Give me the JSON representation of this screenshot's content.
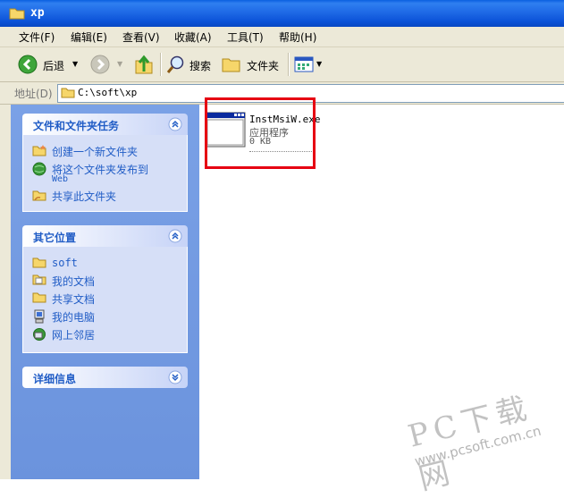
{
  "window": {
    "title": "xp"
  },
  "menu": [
    "文件(F)",
    "编辑(E)",
    "查看(V)",
    "收藏(A)",
    "工具(T)",
    "帮助(H)"
  ],
  "toolbar": {
    "back_label": "后退",
    "search_label": "搜索",
    "folders_label": "文件夹"
  },
  "address": {
    "label": "地址(D)",
    "path": "C:\\soft\\xp"
  },
  "file_tasks": {
    "title": "文件和文件夹任务",
    "items": [
      {
        "label": "创建一个新文件夹",
        "icon": "new-folder-icon"
      },
      {
        "label": "将这个文件夹发布到",
        "label2": "Web",
        "icon": "publish-web-icon"
      },
      {
        "label": "共享此文件夹",
        "icon": "share-folder-icon"
      }
    ]
  },
  "other_places": {
    "title": "其它位置",
    "items": [
      {
        "label": "soft",
        "icon": "folder-icon"
      },
      {
        "label": "我的文档",
        "icon": "my-documents-icon"
      },
      {
        "label": "共享文档",
        "icon": "shared-documents-icon"
      },
      {
        "label": "我的电脑",
        "icon": "my-computer-icon"
      },
      {
        "label": "网上邻居",
        "icon": "network-places-icon"
      }
    ]
  },
  "details": {
    "title": "详细信息"
  },
  "file": {
    "name": "InstMsiW.exe",
    "type": "应用程序",
    "size": "0 KB"
  },
  "watermark": {
    "brand": "PC下载网",
    "url": "www.pcsoft.com.cn"
  }
}
